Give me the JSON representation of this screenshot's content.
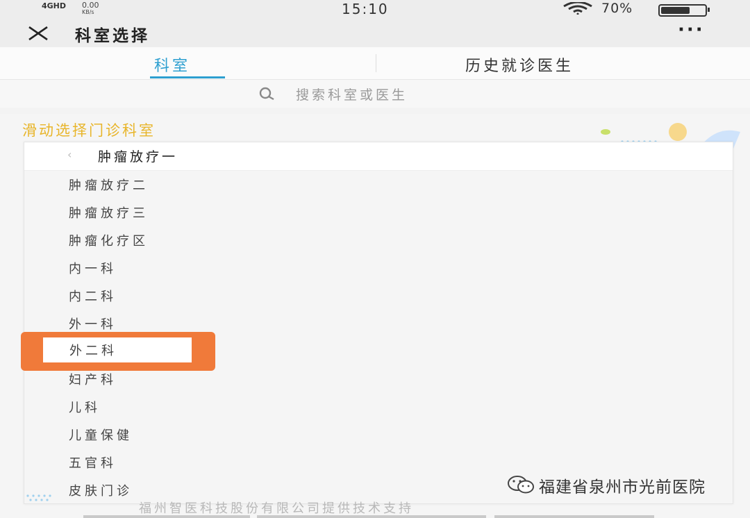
{
  "status_bar": {
    "signal": "4GHD",
    "net_speed": "0.00",
    "net_unit": "KB/s",
    "time": "15:10",
    "battery_text": "70%",
    "battery_level": 0.7
  },
  "nav": {
    "title": "科室选择",
    "more": "···"
  },
  "tabs": [
    {
      "label": "科室",
      "active": true
    },
    {
      "label": "历史就诊医生",
      "active": false
    }
  ],
  "search": {
    "placeholder": "搜索科室或医生"
  },
  "panel": {
    "heading": "滑动选择门诊科室",
    "selected": "肿瘤放疗一",
    "items": [
      "肿瘤放疗二",
      "肿瘤放疗三",
      "肿瘤化疗区",
      "内一科",
      "内二科",
      "外一科",
      "外二科",
      "妇产科",
      "儿科",
      "儿童保健",
      "五官科",
      "皮肤门诊"
    ],
    "highlighted": "外二科"
  },
  "footer": {
    "support_text": "福州智医科技股份有限公司提供技术支持"
  },
  "watermark": {
    "text": "福建省泉州市光前医院"
  },
  "colors": {
    "accent": "#2d9fd0",
    "heading": "#e8b52a",
    "highlight": "#f07a3a"
  },
  "icons": [
    "close-icon",
    "more-icon",
    "search-icon",
    "wifi-icon",
    "battery-icon",
    "chevron-left-icon",
    "wechat-icon"
  ]
}
